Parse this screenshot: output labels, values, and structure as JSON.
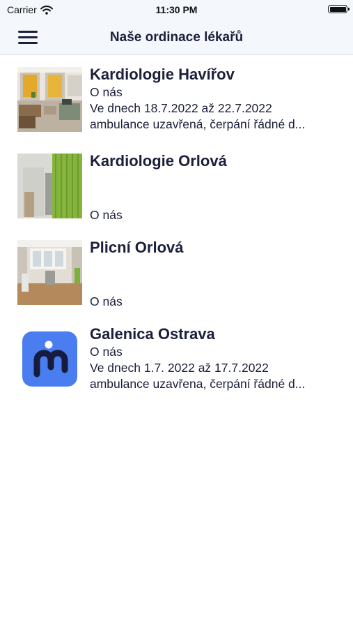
{
  "status_bar": {
    "carrier": "Carrier",
    "time": "11:30 PM"
  },
  "nav": {
    "title": "Naše ordinace lékařů",
    "menu_icon": "hamburger-menu-icon"
  },
  "items": [
    {
      "title": "Kardiologie Havířov",
      "about": "O nás",
      "line1": "Ve dnech 18.7.2022 až 22.7.2022",
      "line2": "ambulance uzavřená, čerpání řádné d..."
    },
    {
      "title": "Kardiologie Orlová",
      "about": "O nás"
    },
    {
      "title": "Plicní Orlová",
      "about": "O nás"
    },
    {
      "title": "Galenica Ostrava",
      "about": "O nás",
      "line1": "Ve dnech 1.7. 2022 až 17.7.2022",
      "line2": "ambulance uzavřena, čerpání řádné d..."
    }
  ],
  "colors": {
    "nav_background": "#f4f8fc",
    "text": "#1b1f3a",
    "logo_background": "#4a7df0"
  }
}
